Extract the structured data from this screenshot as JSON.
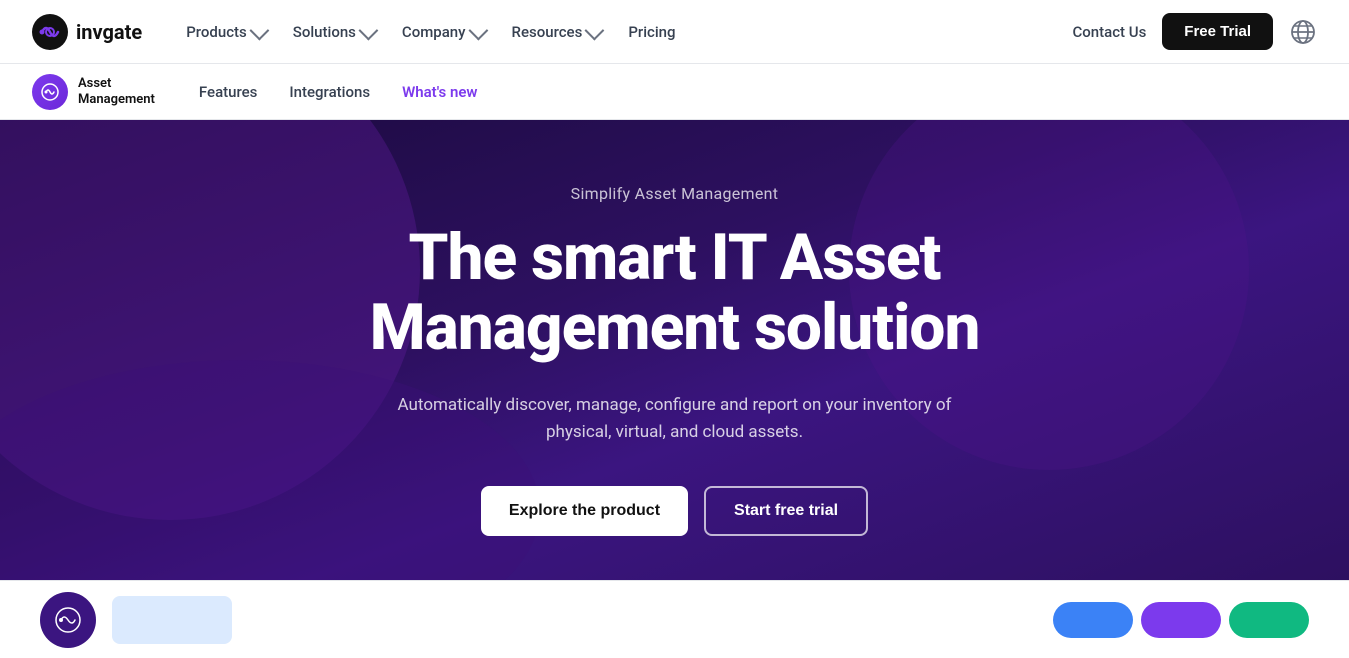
{
  "topNav": {
    "logo": {
      "text": "invgate"
    },
    "links": [
      {
        "label": "Products",
        "hasDropdown": true
      },
      {
        "label": "Solutions",
        "hasDropdown": true
      },
      {
        "label": "Company",
        "hasDropdown": true
      },
      {
        "label": "Resources",
        "hasDropdown": true
      },
      {
        "label": "Pricing",
        "hasDropdown": false
      }
    ],
    "contactUs": "Contact Us",
    "freeTrial": "Free Trial"
  },
  "subNav": {
    "productName": "Asset\nManagement",
    "links": [
      {
        "label": "Features",
        "active": false
      },
      {
        "label": "Integrations",
        "active": false
      },
      {
        "label": "What's new",
        "active": true
      }
    ]
  },
  "hero": {
    "subtitle": "Simplify Asset Management",
    "title": "The smart IT Asset\nManagement solution",
    "description": "Automatically discover, manage, configure and report on your inventory of physical, virtual, and cloud assets.",
    "exploreBtn": "Explore the product",
    "trialBtn": "Start free trial"
  }
}
